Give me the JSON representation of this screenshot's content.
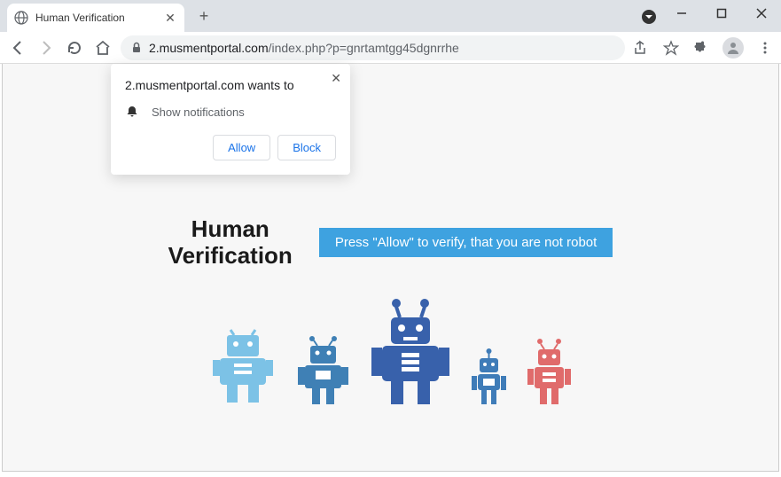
{
  "browser": {
    "tab_title": "Human Verification",
    "url_host": "2.musmentportal.com",
    "url_path": "/index.php?p=gnrtamtgg45dgnrrhe"
  },
  "popup": {
    "title": "2.musmentportal.com wants to",
    "permission_label": "Show notifications",
    "allow_label": "Allow",
    "block_label": "Block"
  },
  "page": {
    "heading": "Human Verification",
    "banner": "Press \"Allow\" to verify, that you are not robot"
  },
  "colors": {
    "banner_bg": "#3ea2e0",
    "robot1": "#7cc2e6",
    "robot2": "#3f80b5",
    "robot3": "#3861ab",
    "robot4": "#3f7cb8",
    "robot5": "#e06b6b"
  }
}
